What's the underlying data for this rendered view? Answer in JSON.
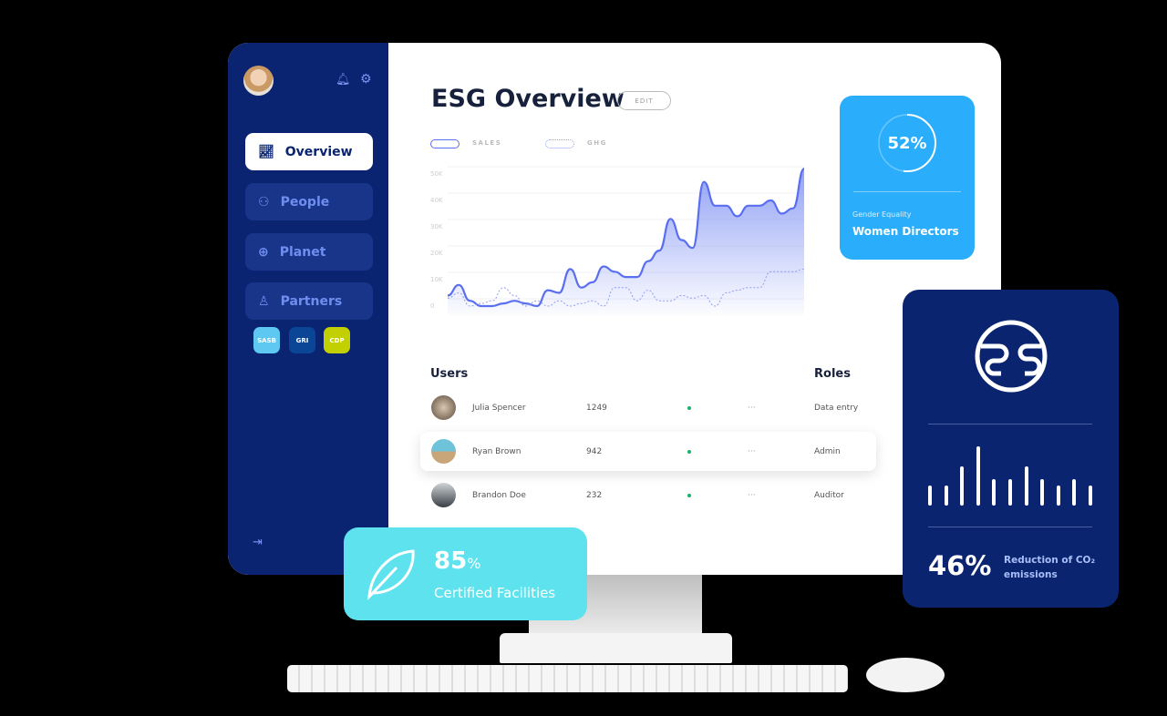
{
  "sidebar": {
    "items": [
      {
        "label": "Overview",
        "icon": "chart-line-icon"
      },
      {
        "label": "People",
        "icon": "people-icon"
      },
      {
        "label": "Planet",
        "icon": "globe-icon"
      },
      {
        "label": "Partners",
        "icon": "partner-icon"
      }
    ],
    "badges": [
      {
        "label": "SASB",
        "color": "#5fc8f2"
      },
      {
        "label": "GRI",
        "color": "#0b4596"
      },
      {
        "label": "CDP",
        "color": "#c2cf00"
      }
    ]
  },
  "header": {
    "title": "ESG Overview",
    "edit_label": "EDIT"
  },
  "chart_data": {
    "type": "area",
    "series": [
      {
        "name": "SALES",
        "values": [
          4,
          8,
          2,
          0,
          0,
          1,
          2,
          1,
          0,
          6,
          5,
          14,
          7,
          9,
          15,
          13,
          11,
          11,
          17,
          21,
          33,
          25,
          22,
          47,
          38,
          38,
          34,
          38,
          38,
          40,
          35,
          37,
          52
        ]
      },
      {
        "name": "GHG",
        "values": [
          3,
          5,
          0,
          1,
          2,
          7,
          4,
          0,
          2,
          0,
          2,
          0,
          1,
          2,
          0,
          7,
          7,
          2,
          6,
          2,
          2,
          4,
          3,
          4,
          0,
          5,
          6,
          7,
          7,
          13,
          13,
          13,
          14
        ]
      }
    ],
    "yticks": [
      "0",
      "10K",
      "20K",
      "30K",
      "40K",
      "50K"
    ],
    "ylim": [
      0,
      52
    ],
    "grid": true,
    "legend": "top-left",
    "colors": {
      "sales": "#5a6ff0",
      "ghg": "#8f9cf5"
    }
  },
  "users": {
    "header": "Users",
    "roles_header": "Roles",
    "rows": [
      {
        "name": "Julia Spencer",
        "count": "1249",
        "role": "Data entry"
      },
      {
        "name": "Ryan Brown",
        "count": "942",
        "role": "Admin"
      },
      {
        "name": "Brandon Doe",
        "count": "232",
        "role": "Auditor"
      }
    ],
    "more": "···"
  },
  "gender": {
    "percent": "52%",
    "progress": 52,
    "subtitle": "Gender Equality",
    "title": "Women Directors"
  },
  "co2": {
    "percent": "46%",
    "label": "Reduction of CO₂ emissions",
    "bars": [
      3,
      3,
      6,
      9,
      4,
      4,
      6,
      4,
      3,
      4,
      3
    ]
  },
  "facilities": {
    "value": "85",
    "unit": "%",
    "label": "Certified Facilities"
  }
}
